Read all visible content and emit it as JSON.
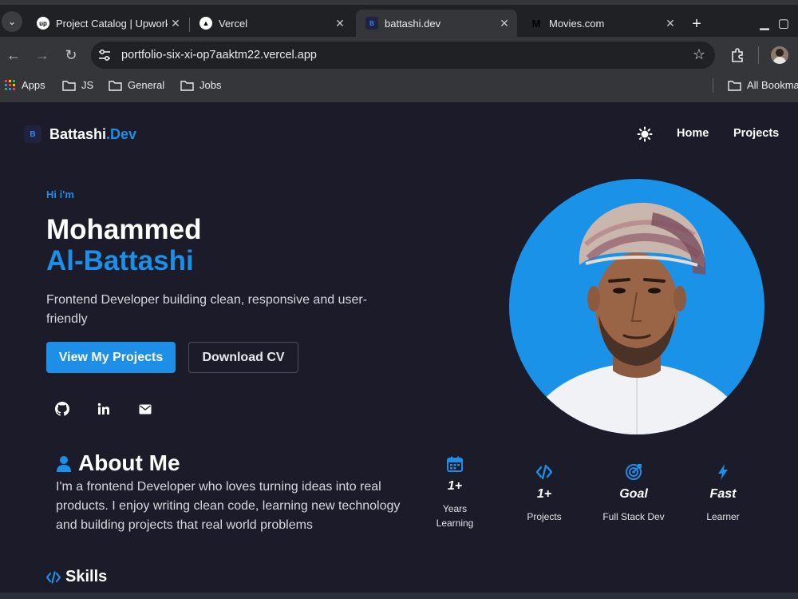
{
  "browser": {
    "tabs": [
      {
        "title": "Project Catalog | Upwork",
        "favicon": "up"
      },
      {
        "title": "Vercel",
        "favicon": "▲"
      },
      {
        "title": "battashi.dev",
        "favicon": "B"
      },
      {
        "title": "Movies.com",
        "favicon": "M"
      }
    ],
    "address": "portfolio-six-xi-op7aaktm22.vercel.app",
    "bookmarks": [
      {
        "label": "Apps"
      },
      {
        "label": "JS"
      },
      {
        "label": "General"
      },
      {
        "label": "Jobs"
      },
      {
        "label": "All Bookmarks"
      }
    ]
  },
  "site": {
    "brand": {
      "badge": "B",
      "name": "Battashi",
      "accent": ".Dev"
    },
    "nav": {
      "home": "Home",
      "projects": "Projects"
    },
    "hero": {
      "greeting": "Hi i'm",
      "first_name": "Mohammed",
      "last_name": "Al-Battashi",
      "tagline": "Frontend Developer building clean, responsive and user-friendly",
      "primary_cta": "View My Projects",
      "secondary_cta": "Download CV"
    },
    "about": {
      "title": "About Me",
      "text": "I'm a frontend Developer who loves turning ideas into real products. I enjoy writing clean code, learning new technology and building projects that real world problems"
    },
    "stats": [
      {
        "value": "1+",
        "label": "Years Learning",
        "icon": "calendar-icon"
      },
      {
        "value": "1+",
        "label": "Projects",
        "icon": "code-icon"
      },
      {
        "value": "Goal",
        "label": "Full Stack Dev",
        "icon": "target-icon"
      },
      {
        "value": "Fast",
        "label": "Learner",
        "icon": "bolt-icon"
      }
    ],
    "skills": {
      "title": "Skills"
    }
  },
  "colors": {
    "accent": "#1e8fe6",
    "background": "#1c1b29",
    "chrome": "#35363a"
  }
}
